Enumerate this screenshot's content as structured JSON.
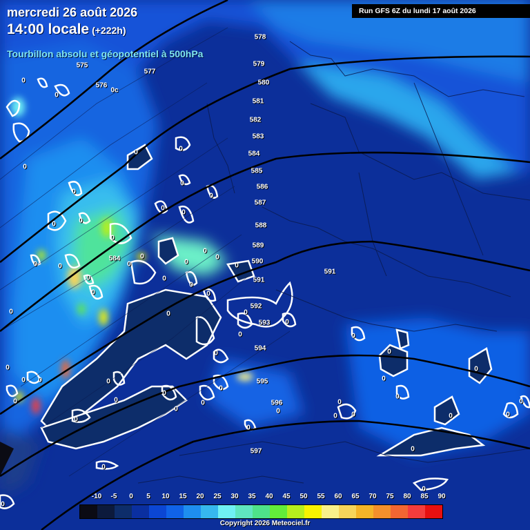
{
  "header": {
    "date": "mercredi 26 août 2026",
    "time": "14:00 locale",
    "offset": "(+222h)",
    "subtitle": "Tourbillon absolu et géopotentiel à 500hPa",
    "run": "Run GFS 6Z du lundi 17 août 2026"
  },
  "contours": {
    "labels": [
      "575",
      "576",
      "577",
      "578",
      "579",
      "580",
      "581",
      "582",
      "583",
      "584",
      "585",
      "586",
      "587",
      "588",
      "589",
      "590",
      "591",
      "592",
      "593",
      "594",
      "595",
      "596",
      "597"
    ],
    "zero_label": "0",
    "misc_label": "0c",
    "low_value": "584"
  },
  "legend": {
    "ticks": [
      "-10",
      "-5",
      "0",
      "5",
      "10",
      "15",
      "20",
      "25",
      "30",
      "35",
      "40",
      "45",
      "50",
      "55",
      "60",
      "65",
      "70",
      "75",
      "80",
      "85",
      "90"
    ],
    "colors": [
      "#0b0b14",
      "#0c1a3c",
      "#0d2d6a",
      "#0a2fa0",
      "#0b46d4",
      "#1063e8",
      "#1e8ef0",
      "#36b8ee",
      "#6ff0f4",
      "#5fe6c0",
      "#4ee28a",
      "#62ec3a",
      "#b6ee1e",
      "#f8f200",
      "#f8f08a",
      "#f6d45a",
      "#f4b428",
      "#f4902c",
      "#f26632",
      "#f43c3c",
      "#e81010"
    ]
  },
  "footer": {
    "copyright": "Copyright 2026 Meteociel.fr"
  }
}
